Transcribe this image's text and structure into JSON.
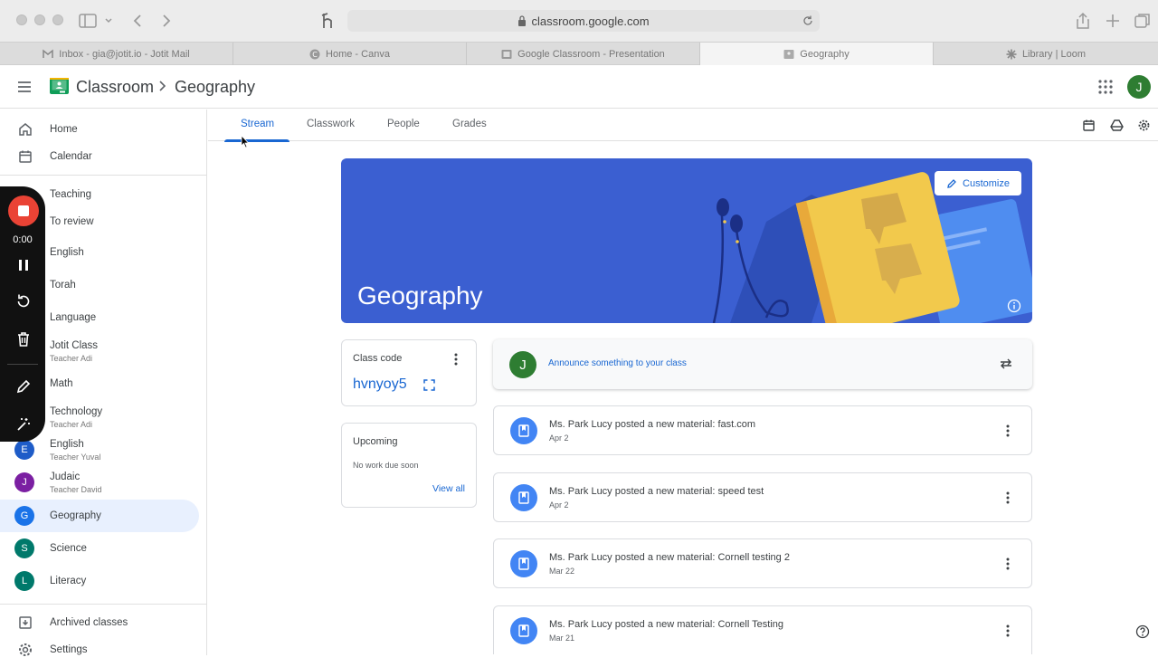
{
  "browser": {
    "url": "classroom.google.com",
    "tabs": [
      {
        "title": "Inbox - gia@jotit.io - Jotit Mail"
      },
      {
        "title": "Home - Canva"
      },
      {
        "title": "Google Classroom - Presentation"
      },
      {
        "title": "Geography"
      },
      {
        "title": "Library | Loom"
      }
    ]
  },
  "header": {
    "brand": "Classroom",
    "class_name": "Geography",
    "user_initial": "J"
  },
  "sidebar": {
    "home": "Home",
    "calendar": "Calendar",
    "teaching": "Teaching",
    "to_review": "To review",
    "classes": [
      {
        "name": "English",
        "teacher": ""
      },
      {
        "name": "Torah",
        "teacher": ""
      },
      {
        "name": "Language",
        "teacher": ""
      },
      {
        "name": "Jotit Class",
        "teacher": "Teacher Adi"
      },
      {
        "name": "Math",
        "teacher": ""
      },
      {
        "name": "Technology",
        "teacher": "Teacher Adi"
      },
      {
        "name": "English",
        "teacher": "Teacher Yuval",
        "initial": "E",
        "color": "#1e5cc8"
      },
      {
        "name": "Judaic",
        "teacher": "Teacher David",
        "initial": "J",
        "color": "#7b1fa2"
      },
      {
        "name": "Geography",
        "teacher": "",
        "initial": "G",
        "color": "#1a73e8"
      },
      {
        "name": "Science",
        "teacher": "",
        "initial": "S",
        "color": "#00796b"
      },
      {
        "name": "Literacy",
        "teacher": "",
        "initial": "L",
        "color": "#00796b"
      }
    ],
    "archived": "Archived classes",
    "settings": "Settings"
  },
  "recorder": {
    "time": "0:00"
  },
  "course_tabs": {
    "stream": "Stream",
    "classwork": "Classwork",
    "people": "People",
    "grades": "Grades"
  },
  "banner": {
    "title": "Geography",
    "customize": "Customize",
    "color": "#3b5fd1"
  },
  "class_code": {
    "title": "Class code",
    "code": "hvnyoy5"
  },
  "upcoming": {
    "title": "Upcoming",
    "empty": "No work due soon",
    "view_all": "View all"
  },
  "announce": {
    "placeholder": "Announce something to your class",
    "avatar_initial": "J"
  },
  "posts": [
    {
      "title": "Ms. Park Lucy posted a new material: fast.com",
      "date": "Apr 2"
    },
    {
      "title": "Ms. Park Lucy posted a new material: speed test",
      "date": "Apr 2"
    },
    {
      "title": "Ms. Park Lucy posted a new material: Cornell testing 2",
      "date": "Mar 22"
    },
    {
      "title": "Ms. Park Lucy posted a new material: Cornell Testing",
      "date": "Mar 21"
    }
  ]
}
